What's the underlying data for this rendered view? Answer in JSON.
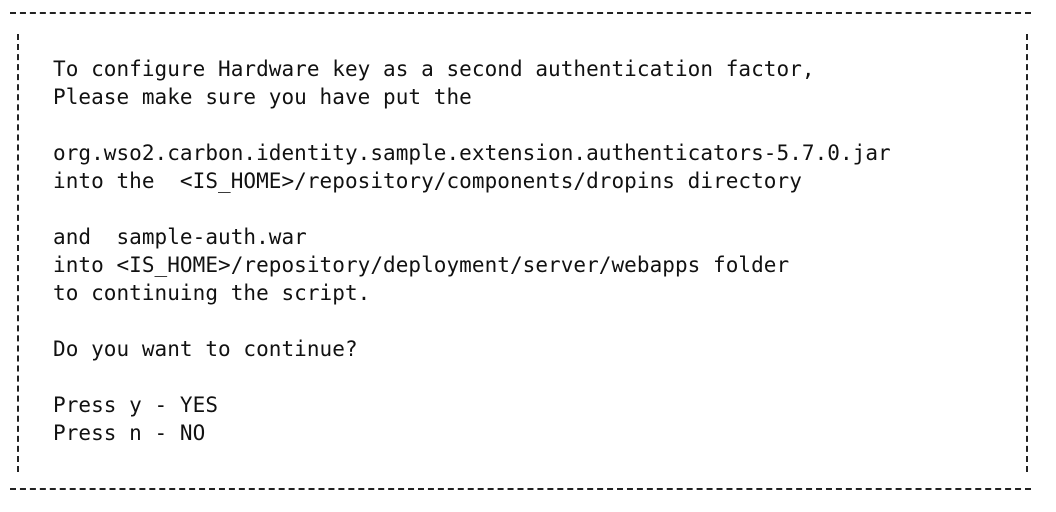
{
  "terminal": {
    "lines": {
      "l1": "To configure Hardware key as a second authentication factor,",
      "l2": "Please make sure you have put the",
      "l3": "org.wso2.carbon.identity.sample.extension.authenticators-5.7.0.jar",
      "l4": "into the  <IS_HOME>/repository/components/dropins directory",
      "l5": "and  sample-auth.war",
      "l6": "into <IS_HOME>/repository/deployment/server/webapps folder",
      "l7": "to continuing the script.",
      "l8": "Do you want to continue?",
      "l9": "Press y - YES",
      "l10": "Press n - NO"
    }
  }
}
